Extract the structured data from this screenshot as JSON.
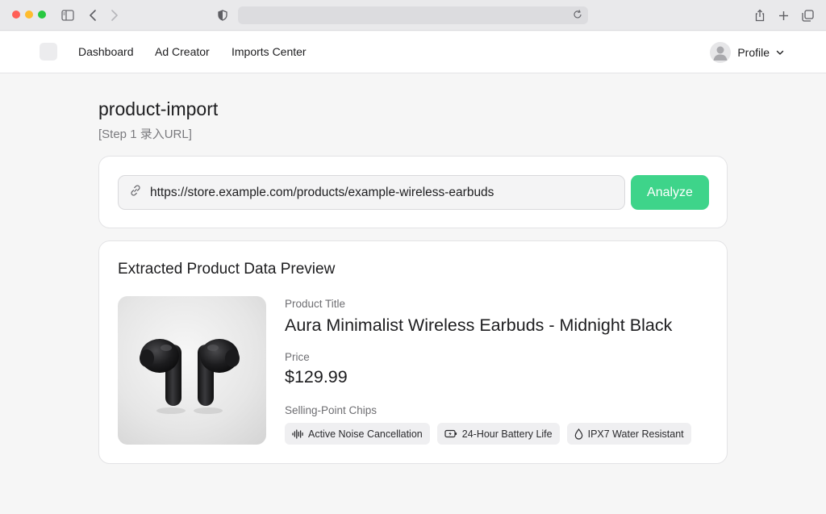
{
  "browser": {
    "address_value": ""
  },
  "nav": {
    "items": [
      {
        "label": "Dashboard"
      },
      {
        "label": "Ad Creator"
      },
      {
        "label": "Imports Center"
      }
    ],
    "profile_label": "Profile"
  },
  "page": {
    "title": "product-import",
    "subtitle": "[Step 1 录入URL]"
  },
  "url_card": {
    "url_value": "https://store.example.com/products/example-wireless-earbuds",
    "analyze_label": "Analyze",
    "accent": "#3ed48a"
  },
  "preview": {
    "heading": "Extracted Product Data Preview",
    "title_label": "Product Title",
    "title_value": "Aura Minimalist Wireless Earbuds - Midnight Black",
    "price_label": "Price",
    "price_value": "$129.99",
    "chips_label": "Selling-Point Chips",
    "chips": [
      {
        "icon": "waveform-icon",
        "label": "Active Noise Cancellation"
      },
      {
        "icon": "battery-icon",
        "label": "24-Hour Battery Life"
      },
      {
        "icon": "water-drop-icon",
        "label": "IPX7 Water Resistant"
      }
    ]
  }
}
